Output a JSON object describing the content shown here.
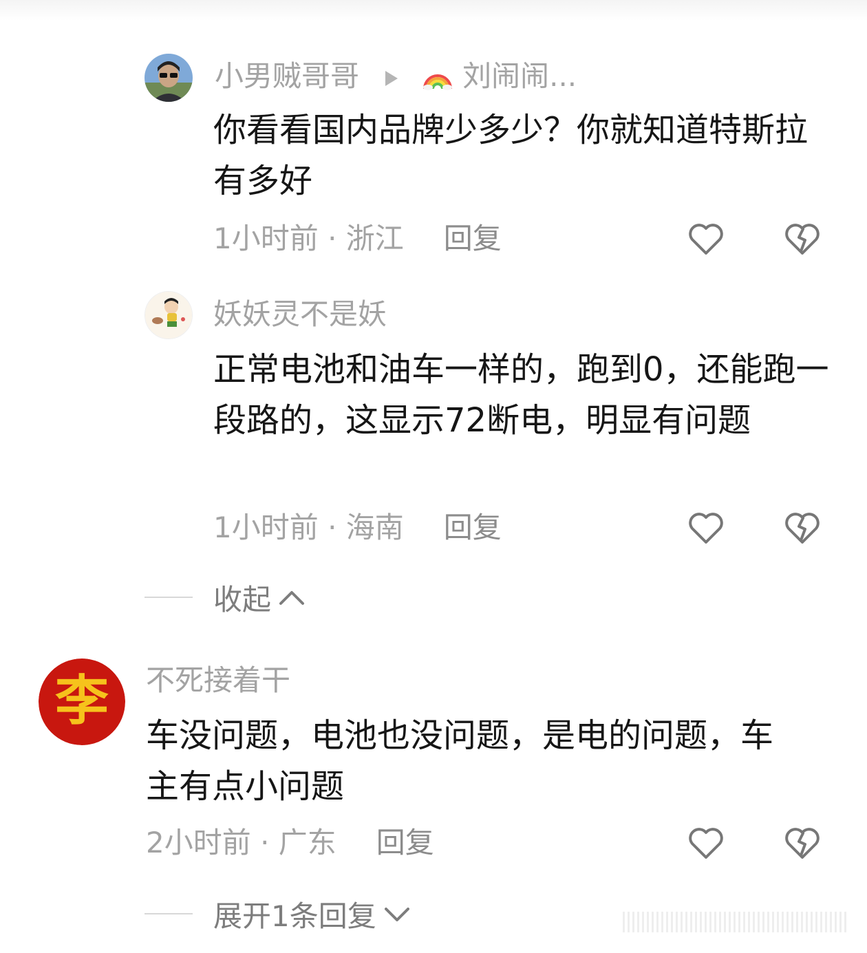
{
  "comments": [
    {
      "author": "小男贼哥哥",
      "reply_to": "刘闹闹...",
      "text": "你看看国内品牌少多少？你就知道特斯拉有多好",
      "time": "1小时前 · 浙江",
      "reply_label": "回复"
    },
    {
      "author": "妖妖灵不是妖",
      "text": "正常电池和油车一样的，跑到0，还能跑一段路的，这显示72断电，明显有问题",
      "time": "1小时前 · 海南",
      "reply_label": "回复"
    },
    {
      "author": "不死接着干",
      "avatar_char": "李",
      "text": "车没问题，电池也没问题，是电的问题，车主有点小问题",
      "time": "2小时前 · 广东",
      "reply_label": "回复"
    }
  ],
  "collapse_label": "收起",
  "expand_label": "展开1条回复",
  "icons": {
    "like": "heart-outline-icon",
    "dislike": "broken-heart-icon",
    "collapse": "chevron-up-icon",
    "expand": "chevron-down-icon",
    "reply_arrow": "play-triangle-icon",
    "rainbow": "rainbow-emoji"
  },
  "colors": {
    "text": "#161616",
    "secondary": "#a3a3a3",
    "avatar_red": "#c8170f",
    "avatar_gold": "#f6c21c"
  }
}
